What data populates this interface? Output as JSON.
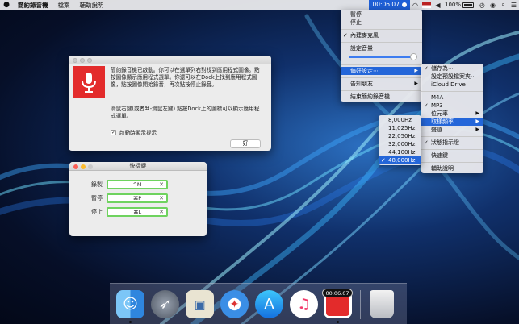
{
  "colors": {
    "menu_highlight": "#2466d9",
    "record_red": "#e32b2b",
    "shortcut_field_border": "#6fd35f",
    "timer_background": "#1f5fd6"
  },
  "menubar": {
    "app_name": "簡約錄音機",
    "items": [
      "檔案",
      "輔助說明"
    ]
  },
  "status_bar": {
    "timer": "00:06.07",
    "battery": "100%"
  },
  "status_menu": {
    "items": [
      "暫停",
      "停止",
      "內建麥克風",
      "設定音量",
      "偏好設定⋯",
      "告知朋友",
      "結束簡約錄音機"
    ],
    "volume_level": 1.0
  },
  "preferences_menu": {
    "items": [
      "儲存為⋯",
      "設定預設檔案夾⋯",
      "iCloud Drive",
      "M4A",
      "MP3",
      "位元率",
      "取樣頻率",
      "聲道",
      "狀態指示燈",
      "快速鍵",
      "輔助說明"
    ]
  },
  "sample_rate_menu": {
    "items": [
      "8,000Hz",
      "11,025Hz",
      "22,050Hz",
      "32,000Hz",
      "44,100Hz",
      "48,000Hz"
    ]
  },
  "launch_window": {
    "paragraph1": "簡約錄音機已啟動。你可以在選單列右對找到應用程式圖像。點按圖像顯示應用程式選單。你還可以在Dock上找到應用程式圖像，點按圖像開始錄音，再次點按停止錄音。",
    "paragraph2": "滑鼠右鍵(或者⌘-滑鼠左鍵) 點按Dock上的圖標可以顯示應用程式選單。",
    "checkbox_label": "啟動時顯示提示",
    "ok_button": "好"
  },
  "shortcuts_window": {
    "title": "快捷鍵",
    "rows": [
      {
        "label": "錄製",
        "shortcut": "^M"
      },
      {
        "label": "暫停",
        "shortcut": "⌘P"
      },
      {
        "label": "停止",
        "shortcut": "⌘L"
      }
    ]
  },
  "dock": {
    "recording_badge": "00:06.07",
    "apps": [
      "finder-icon",
      "launchpad-icon",
      "preview-icon",
      "safari-icon",
      "app-store-icon",
      "itunes-icon",
      "recorder-icon",
      "trash-icon"
    ]
  }
}
